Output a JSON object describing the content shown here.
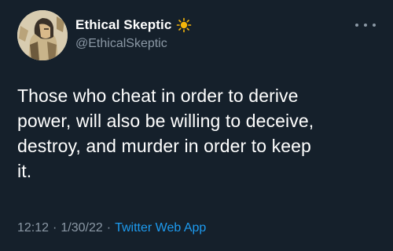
{
  "user": {
    "display_name": "Ethical Skeptic",
    "handle": "@EthicalSkeptic",
    "emoji_icon": "sun-icon"
  },
  "tweet": {
    "text": "Those who cheat in order to derive\npower, will also be willing to deceive,\ndestroy, and murder in order to keep\nit.",
    "time": "12:12",
    "separator": "·",
    "date": "1/30/22",
    "source": "Twitter Web App"
  },
  "colors": {
    "background": "#15202b",
    "text": "#ffffff",
    "secondary": "#8b98a5",
    "link": "#1d9bf0",
    "sun": "#f5b60a"
  }
}
